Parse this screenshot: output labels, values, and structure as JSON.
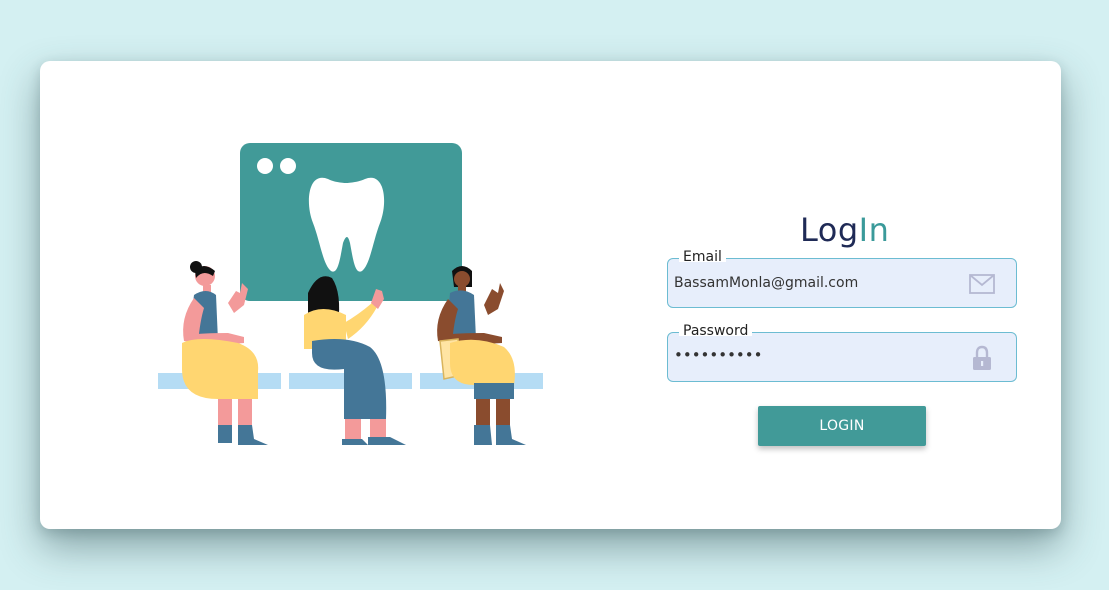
{
  "login": {
    "title_part1": "Log",
    "title_part2": "In",
    "email": {
      "label": "Email",
      "value": "BassamMonla@gmail.com",
      "icon": "mail-icon"
    },
    "password": {
      "label": "Password",
      "value": "••••••••••",
      "icon": "lock-icon"
    },
    "button_label": "LOGIN"
  },
  "colors": {
    "background": "#d4f0f2",
    "accent": "#419a98",
    "title_dark": "#1f2a56",
    "field_bg": "#e7eefb",
    "field_border": "#6cbcd2"
  }
}
